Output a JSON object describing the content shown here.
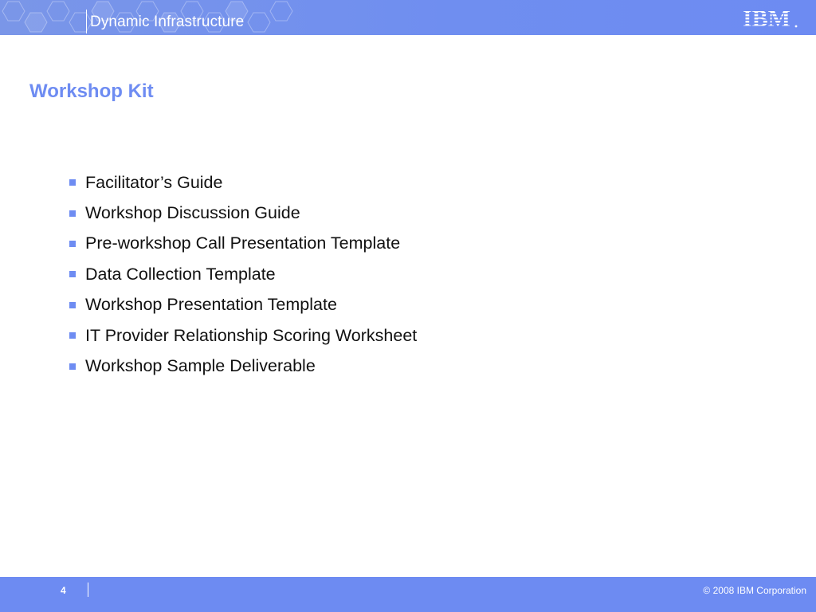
{
  "header": {
    "title": "Dynamic Infrastructure",
    "logo_text": "IBM",
    "logo_icon": "ibm-logo-icon"
  },
  "slide": {
    "title": "Workshop Kit",
    "bullets": [
      "Facilitator’s Guide",
      "Workshop Discussion Guide",
      "Pre-workshop Call Presentation Template",
      "Data Collection Template",
      "Workshop Presentation Template",
      "IT Provider Relationship Scoring Worksheet",
      "Workshop Sample Deliverable"
    ]
  },
  "footer": {
    "page_number": "4",
    "copyright": "© 2008 IBM Corporation"
  },
  "colors": {
    "accent": "#6e8cf2",
    "header_bg": "#7a96e8",
    "text": "#111111"
  }
}
